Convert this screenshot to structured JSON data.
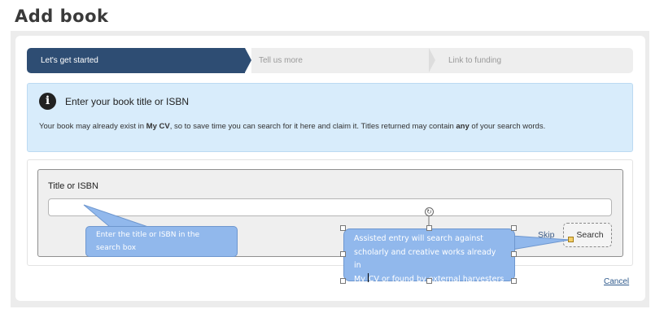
{
  "page": {
    "title": "Add book"
  },
  "stepper": {
    "steps": [
      {
        "label": "Let's get started",
        "state": "active"
      },
      {
        "label": "Tell us more",
        "state": "inactive"
      },
      {
        "label": "Link to funding",
        "state": "inactive"
      }
    ]
  },
  "info": {
    "icon": "info-circle-icon",
    "title": "Enter your book title or ISBN",
    "text_part1": "Your book may already exist in ",
    "text_bold1": "My CV",
    "text_part2": ", so to save time you can search for it here and claim it. Titles returned may contain ",
    "text_bold2": "any",
    "text_part3": " of your search words."
  },
  "search": {
    "label": "Title or ISBN",
    "value": "",
    "skip_label": "Skip",
    "search_label": "Search"
  },
  "footer": {
    "cancel_label": "Cancel"
  },
  "callouts": {
    "input_hint_line1": "Enter the title or ISBN in the",
    "input_hint_line2": "search box",
    "assisted_line1": "Assisted entry will search against",
    "assisted_line2": "scholarly and creative works already in",
    "assisted_line3a": "My ",
    "assisted_line3b": "CV or found by external harvesters"
  },
  "colors": {
    "active_step": "#2e4d73",
    "info_bg": "#d8ecfb",
    "callout_bg": "#91b8ec",
    "link": "#2f5a8c"
  }
}
